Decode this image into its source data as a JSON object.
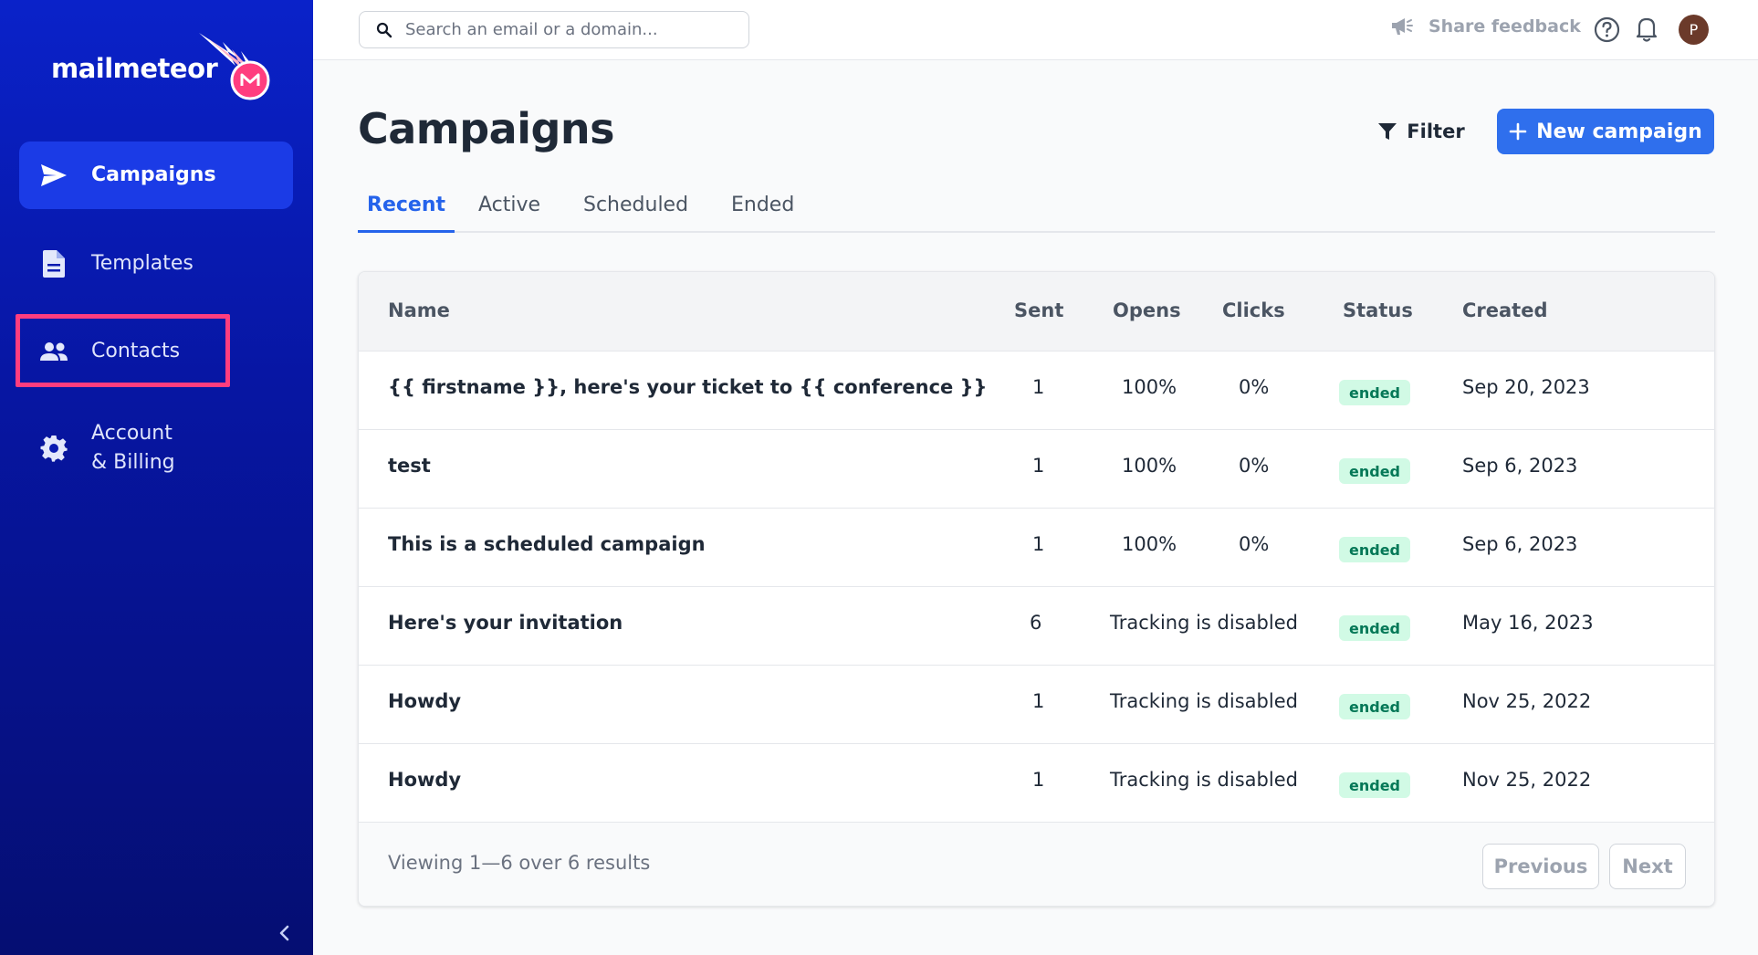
{
  "sidebar": {
    "logo_text": "mailmeteor",
    "items": [
      {
        "label": "Campaigns",
        "icon": "send-icon"
      },
      {
        "label": "Templates",
        "icon": "document-icon"
      },
      {
        "label": "Contacts",
        "icon": "users-icon"
      },
      {
        "label_line1": "Account",
        "label_line2": "& Billing",
        "icon": "gear-icon"
      }
    ],
    "collapse_icon": "chevron-left-icon"
  },
  "topbar": {
    "search_placeholder": "Search an email or a domain...",
    "feedback_label": "Share feedback",
    "avatar_initial": "P"
  },
  "main": {
    "title": "Campaigns",
    "filter_label": "Filter",
    "new_campaign_label": "New campaign",
    "tabs": [
      "Recent",
      "Active",
      "Scheduled",
      "Ended"
    ],
    "active_tab": "Recent",
    "columns": [
      "Name",
      "Sent",
      "Opens",
      "Clicks",
      "Status",
      "Created"
    ],
    "rows": [
      {
        "name": "{{ firstname }}, here's your ticket to {{ conference }}",
        "sent": "1",
        "opens": "100%",
        "clicks": "0%",
        "status": "ended",
        "created": "Sep 20, 2023"
      },
      {
        "name": "test",
        "sent": "1",
        "opens": "100%",
        "clicks": "0%",
        "status": "ended",
        "created": "Sep 6, 2023"
      },
      {
        "name": "This is a scheduled campaign",
        "sent": "1",
        "opens": "100%",
        "clicks": "0%",
        "status": "ended",
        "created": "Sep 6, 2023"
      },
      {
        "name": "Here's your invitation",
        "sent": "6",
        "tracking": "Tracking is disabled",
        "status": "ended",
        "created": "May 16, 2023"
      },
      {
        "name": "Howdy",
        "sent": "1",
        "tracking": "Tracking is disabled",
        "status": "ended",
        "created": "Nov 25, 2022"
      },
      {
        "name": "Howdy",
        "sent": "1",
        "tracking": "Tracking is disabled",
        "status": "ended",
        "created": "Nov 25, 2022"
      }
    ],
    "footer_text": "Viewing 1—6 over 6 results",
    "previous_label": "Previous",
    "next_label": "Next"
  },
  "colors": {
    "sidebar_top": "#0a22c9",
    "sidebar_bottom": "#050e72",
    "accent": "#2f6fed",
    "highlight": "#ff3d7f",
    "badge_bg": "#d1fae5",
    "badge_text": "#047857"
  }
}
